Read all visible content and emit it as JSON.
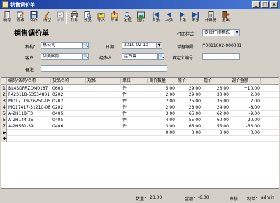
{
  "window": {
    "title": "销售调价单"
  },
  "toolbar": [
    {
      "id": "new",
      "label": "新增",
      "icon": "new-doc-icon",
      "disabled": false
    },
    {
      "id": "modify",
      "label": "修改",
      "icon": "edit-icon",
      "disabled": false
    },
    {
      "id": "save",
      "label": "保存",
      "icon": "save-icon",
      "disabled": false
    },
    {
      "id": "clear",
      "label": "清空",
      "icon": "clear-icon",
      "disabled": false
    },
    {
      "id": "audit",
      "label": "审核",
      "icon": "audit-icon",
      "disabled": true
    },
    {
      "id": "print",
      "label": "打印",
      "icon": "print-icon",
      "disabled": false
    },
    {
      "id": "preview",
      "label": "预览",
      "icon": "preview-icon",
      "disabled": false
    },
    {
      "id": "import",
      "label": "导入",
      "icon": "import-icon",
      "disabled": false
    },
    {
      "id": "export",
      "label": "导出",
      "icon": "export-icon",
      "disabled": false
    },
    {
      "id": "locate",
      "label": "定位",
      "icon": "locate-icon",
      "disabled": false
    },
    {
      "id": "image",
      "label": "图片",
      "icon": "image-icon",
      "disabled": false
    },
    {
      "id": "first",
      "label": "首张",
      "icon": "first-icon",
      "disabled": false
    },
    {
      "id": "prev",
      "label": "上张",
      "icon": "prev-icon",
      "disabled": false
    },
    {
      "id": "next",
      "label": "下张",
      "icon": "next-icon",
      "disabled": false
    },
    {
      "id": "last",
      "label": "末张",
      "icon": "last-icon",
      "disabled": false
    },
    {
      "id": "calc",
      "label": "计算器",
      "icon": "calculator-icon",
      "disabled": false
    },
    {
      "id": "exit",
      "label": "退出",
      "icon": "exit-icon",
      "disabled": false
    }
  ],
  "form": {
    "heading": "销售调价单",
    "print_style_label": "打印样式：",
    "print_style_value": "传统打印样式",
    "org_label": "机构：",
    "org_value": "总公司",
    "date_label": "日期：",
    "date_value": "2010-02-10",
    "doc_no_label": "单据编号：",
    "doc_no_value": "JY0011002-000001",
    "customer_label": "客户：",
    "customer_value": "华美国际",
    "handler_label": "经办人：",
    "handler_value": "赵古曾",
    "custom_no_label": "自定义编号：",
    "custom_no_value": "",
    "remark_label": "备注：",
    "remark_value": ""
  },
  "grid": {
    "columns": [
      "编码/条码/名称",
      "货品名称",
      "规格",
      "单位",
      "调价数量",
      "原价",
      "现价",
      "调价金额"
    ],
    "rows": [
      {
        "rn": "1",
        "code": "BL4SDFRZDM0187",
        "name": "0603",
        "spec": "",
        "unit": "件",
        "qty": "5.00",
        "orig": "29.00",
        "now": "23.00",
        "amount": "+10.00"
      },
      {
        "rn": "2",
        "code": "F423118-63534801",
        "name": "0202",
        "spec": "",
        "unit": "件",
        "qty": "2.00",
        "orig": "29.00",
        "now": "30.00",
        "amount": "2.00"
      },
      {
        "rn": "3",
        "code": "MO17119-26250-05",
        "name": "0202",
        "spec": "",
        "unit": "件",
        "qty": "2.00",
        "orig": "25.00",
        "now": "36.00",
        "amount": "2.00"
      },
      {
        "rn": "4",
        "code": "MO17417-31210-08",
        "name": "0202",
        "spec": "",
        "unit": "件",
        "qty": "2.00",
        "orig": "28.00",
        "now": "24.00",
        "amount": "-8.00"
      },
      {
        "rn": "5",
        "code": "A-2H118-T3",
        "name": "0405",
        "spec": "",
        "unit": "件",
        "qty": "3.00",
        "orig": "65.00",
        "now": "62.00",
        "amount": "-9.00"
      },
      {
        "rn": "6",
        "code": "A-2H144-25",
        "name": "0405",
        "spec": "",
        "unit": "件",
        "qty": "4.00",
        "orig": "55.00",
        "now": "60.00",
        "amount": "20.00"
      },
      {
        "rn": "7",
        "code": "A-2H561-39",
        "name": "0406",
        "spec": "",
        "unit": "件",
        "qty": "3.00",
        "orig": "66.00",
        "now": "55.00",
        "amount": "-33.00"
      },
      {
        "rn": "▶8",
        "code": "",
        "name": "",
        "spec": "",
        "unit": "",
        "qty": "0.00",
        "orig": "0.00",
        "now": "0.00",
        "amount": "0.00"
      },
      {
        "rn": "✱0",
        "code": "",
        "name": "",
        "spec": "",
        "unit": "",
        "qty": "",
        "orig": "",
        "now": "",
        "amount": ""
      }
    ]
  },
  "status": {
    "qty_label": "数量：",
    "qty_value": "23.00",
    "amount_label": "金额：",
    "amount_value": "-6.00",
    "auditor_label": "审核：",
    "auditor_value": "",
    "maker_label": "制单：",
    "maker_value": "admin"
  }
}
